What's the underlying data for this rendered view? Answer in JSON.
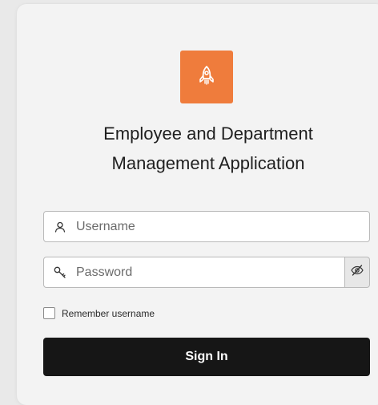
{
  "app": {
    "title_line1": "Employee and Department",
    "title_line2": "Management Application"
  },
  "login": {
    "username_placeholder": "Username",
    "password_placeholder": "Password",
    "remember_label": "Remember username",
    "remember_checked": false,
    "signin_label": "Sign In"
  },
  "icons": {
    "logo": "rocket-icon",
    "username": "user-icon",
    "password": "key-icon",
    "reveal": "eye-slash-icon"
  },
  "colors": {
    "logo_bg": "#ef7c3c",
    "button_bg": "#161616"
  }
}
